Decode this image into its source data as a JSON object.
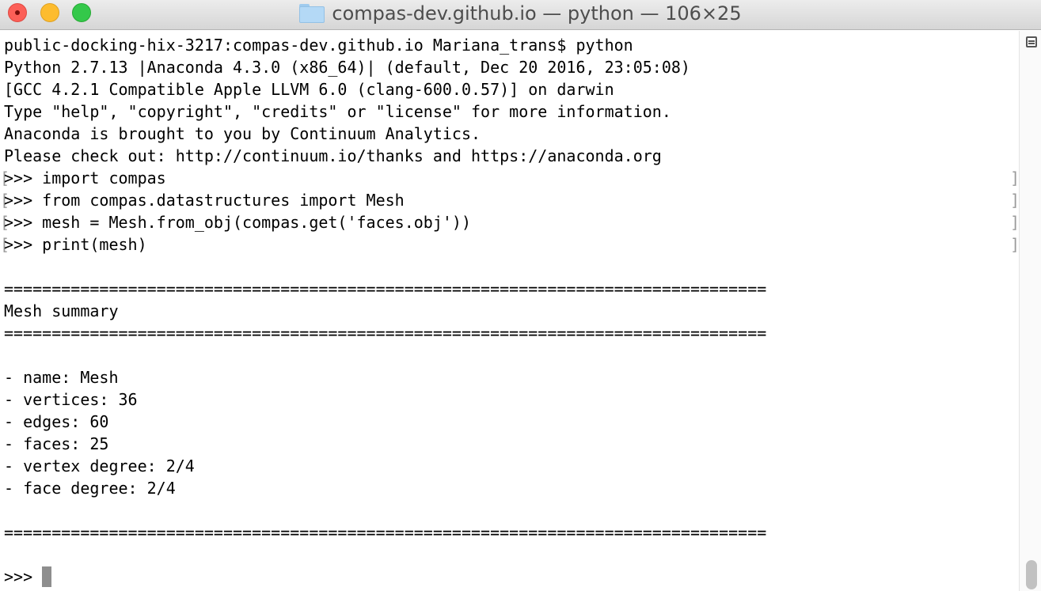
{
  "window": {
    "title": "compas-dev.github.io — python — 106×25",
    "folder_icon": "folder-icon"
  },
  "terminal": {
    "lines": [
      "public-docking-hix-3217:compas-dev.github.io Mariana_trans$ python",
      "Python 2.7.13 |Anaconda 4.3.0 (x86_64)| (default, Dec 20 2016, 23:05:08)",
      "[GCC 4.2.1 Compatible Apple LLVM 6.0 (clang-600.0.57)] on darwin",
      "Type \"help\", \"copyright\", \"credits\" or \"license\" for more information.",
      "Anaconda is brought to you by Continuum Analytics.",
      "Please check out: http://continuum.io/thanks and https://anaconda.org",
      ">>> import compas",
      ">>> from compas.datastructures import Mesh",
      ">>> mesh = Mesh.from_obj(compas.get('faces.obj'))",
      ">>> print(mesh)",
      "",
      "================================================================================",
      "Mesh summary",
      "================================================================================",
      "",
      "- name: Mesh",
      "- vertices: 36",
      "- edges: 60",
      "- faces: 25",
      "- vertex degree: 2/4",
      "- face degree: 2/4",
      "",
      "================================================================================",
      "",
      ">>> "
    ],
    "mark_open": "[",
    "mark_close": "]"
  },
  "colors": {
    "close": "#fc5f57",
    "minimize": "#fdbc2e",
    "maximize": "#34c84a",
    "cursor": "#8e8e8e"
  }
}
